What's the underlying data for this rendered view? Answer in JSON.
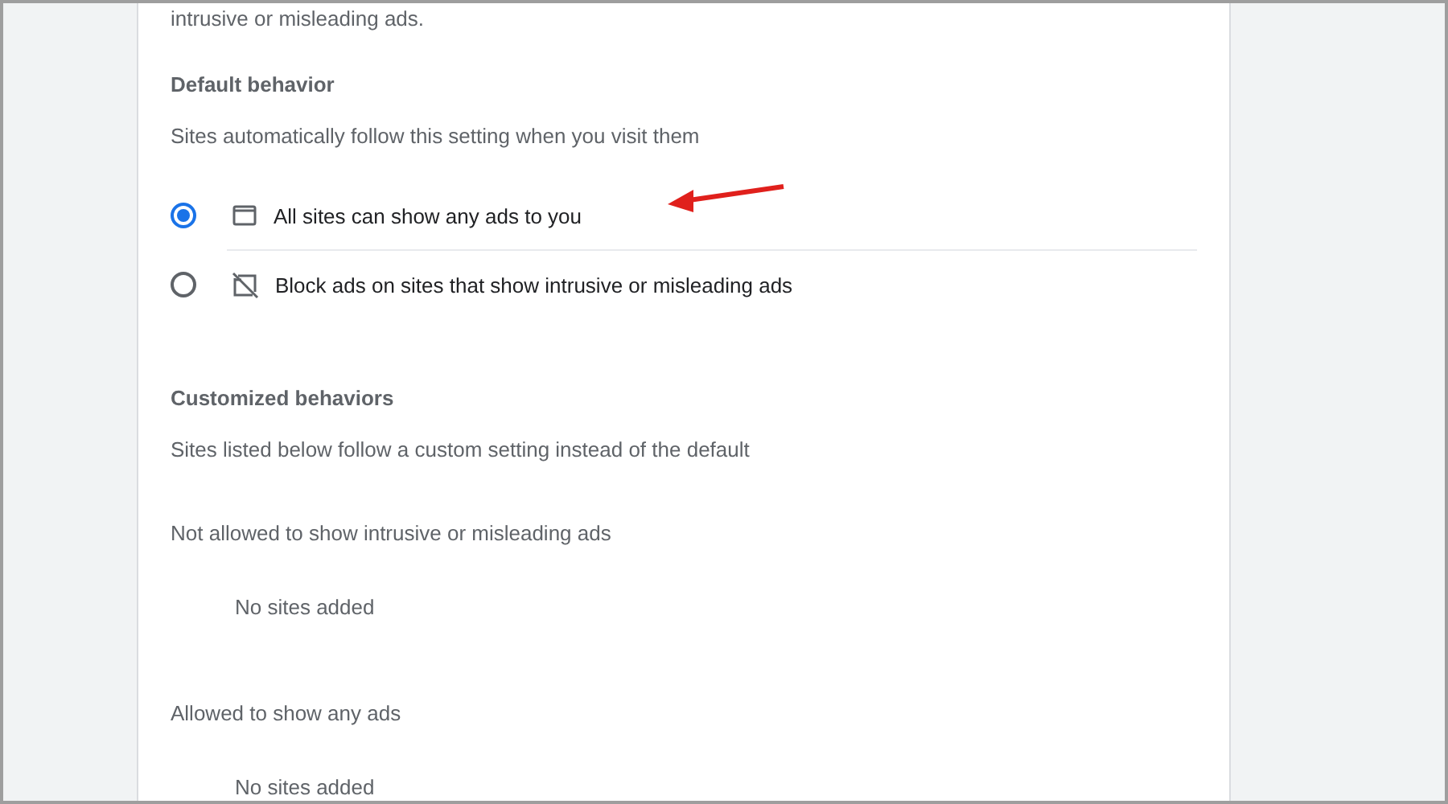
{
  "top_text": "intrusive or misleading ads.",
  "default_behavior": {
    "title": "Default behavior",
    "description": "Sites automatically follow this setting when you visit them",
    "options": [
      {
        "kind": "allow",
        "label": "All sites can show any ads to you",
        "selected": true
      },
      {
        "kind": "block",
        "label": "Block ads on sites that show intrusive or misleading ads",
        "selected": false
      }
    ]
  },
  "customized_behaviors": {
    "title": "Customized behaviors",
    "description": "Sites listed below follow a custom setting instead of the default",
    "lists": [
      {
        "title": "Not allowed to show intrusive or misleading ads",
        "empty_text": "No sites added"
      },
      {
        "title": "Allowed to show any ads",
        "empty_text": "No sites added"
      }
    ]
  }
}
